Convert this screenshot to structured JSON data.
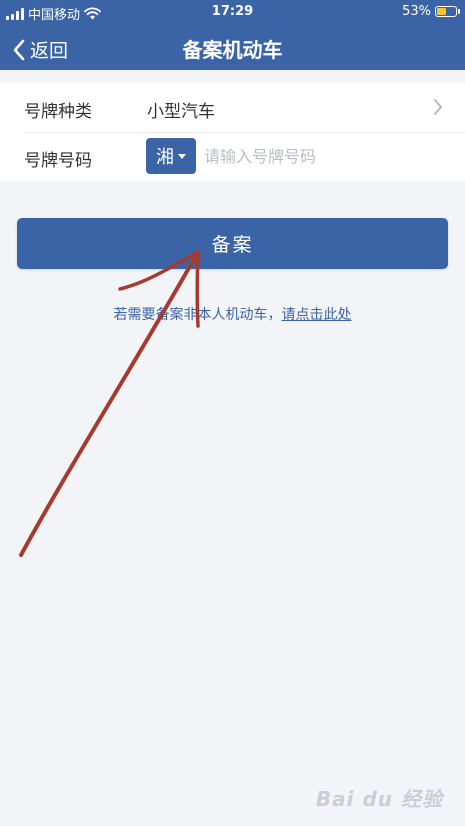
{
  "status_bar": {
    "carrier": "中国移动",
    "time": "17:29",
    "battery_percent": "53%",
    "battery_level": 0.53,
    "battery_color": "#f7c531"
  },
  "nav": {
    "back_label": "返回",
    "title": "备案机动车",
    "back_icon": "chevron-left-icon"
  },
  "form": {
    "plate_type_label": "号牌种类",
    "plate_type_value": "小型汽车",
    "plate_number_label": "号牌号码",
    "province_value": "湘",
    "plate_number_placeholder": "请输入号牌号码",
    "plate_number_value": ""
  },
  "actions": {
    "register_label": "备案",
    "hint_text": "若需要备案非本人机动车，",
    "hint_link": "请点击此处"
  },
  "watermark": {
    "text": "Bai du 经验"
  },
  "colors": {
    "accent": "#3a64a6",
    "background": "#f2f4f7",
    "annotation_stroke": "#a63a2e"
  }
}
